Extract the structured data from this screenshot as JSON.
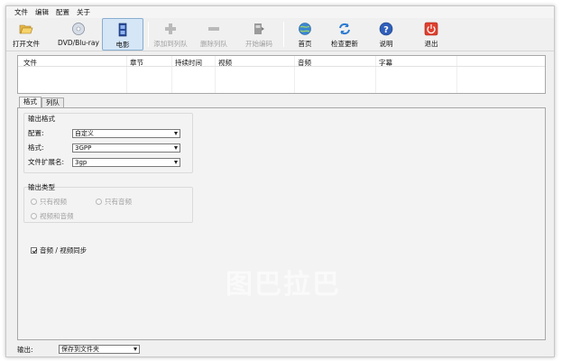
{
  "menu": [
    "文件",
    "编辑",
    "配置",
    "关于"
  ],
  "toolbar": {
    "open_file": "打开文件",
    "dvd": "DVD/Blu-ray",
    "movie": "电影",
    "add_to_queue": "添加到列队",
    "remove_from_queue": "删除列队",
    "start_encode": "开始编码",
    "home": "首页",
    "check_update": "检查更新",
    "help": "说明",
    "exit": "退出"
  },
  "file_table": {
    "columns": [
      "文件",
      "章节",
      "持续时间",
      "视频",
      "音频",
      "字幕"
    ]
  },
  "tabs": [
    "格式",
    "列队"
  ],
  "format": {
    "output_format_group": "输出格式",
    "profile_label": "配置:",
    "profile_value": "自定义",
    "format_label": "格式:",
    "format_value": "3GPP",
    "extension_label": "文件扩展名:",
    "extension_value": "3gp"
  },
  "output_type": {
    "group": "输出类型",
    "video_only": "只有视频",
    "audio_only": "只有音频",
    "video_audio": "视频和音频"
  },
  "sync": {
    "label": "音频 / 视频同步",
    "checked": true
  },
  "output": {
    "label": "输出:",
    "value": "保存到文件夹"
  },
  "watermark": "图巴拉巴"
}
